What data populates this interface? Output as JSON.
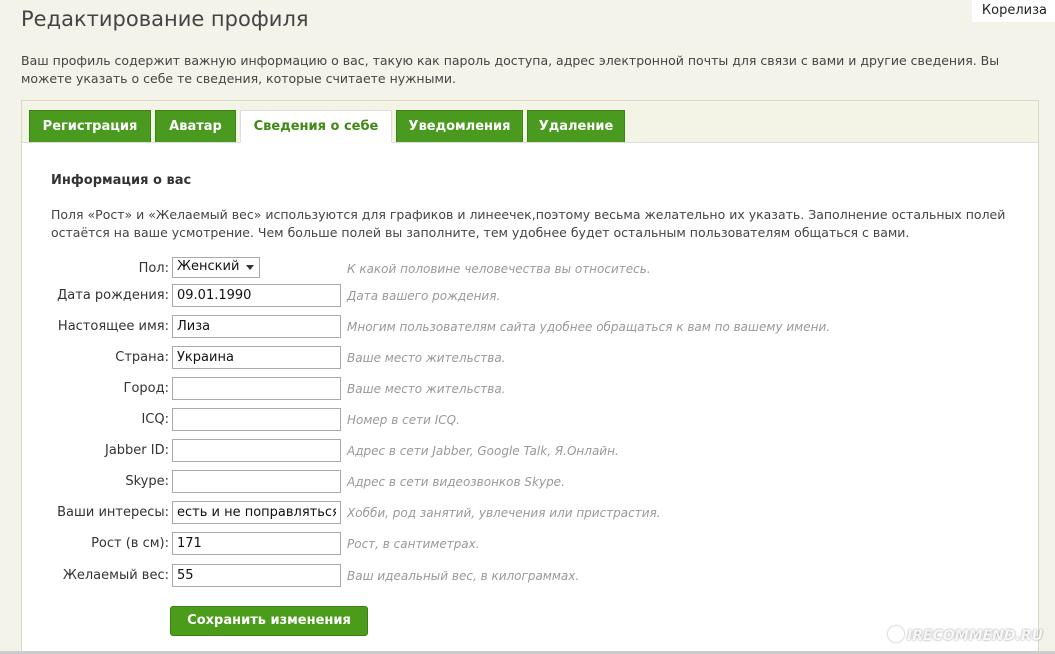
{
  "page": {
    "title": "Редактирование профиля",
    "user_name": "Корелиза",
    "intro": "Ваш профиль содержит важную информацию о вас, такую как пароль доступа, адрес электронной почты для связи с вами и другие сведения. Вы можете указать о себе те сведения, которые считаете нужными."
  },
  "tabs": [
    {
      "label": "Регистрация"
    },
    {
      "label": "Аватар"
    },
    {
      "label": "Сведения о себе"
    },
    {
      "label": "Уведомления"
    },
    {
      "label": "Удаление"
    }
  ],
  "active_tab": "Сведения о себе",
  "section": {
    "title": "Информация о вас",
    "description": "Поля «Рост» и «Желаемый вес» используются для графиков и линеечек,поэтому весьма желательно их указать. Заполнение остальных полей остаётся на ваше усмотрение. Чем больше полей вы заполните, тем удобнее будет остальным пользователям общаться с вами."
  },
  "fields": {
    "gender": {
      "label": "Пол:",
      "value": "Женский",
      "hint": "К какой половине человечества вы относитесь."
    },
    "birthdate": {
      "label": "Дата рождения:",
      "value": "09.01.1990",
      "hint": "Дата вашего рождения."
    },
    "real_name": {
      "label": "Настоящее имя:",
      "value": "Лиза",
      "hint": "Многим пользователям сайта удобнее обращаться к вам по вашему имени."
    },
    "country": {
      "label": "Страна:",
      "value": "Украина",
      "hint": "Ваше место жительства."
    },
    "city": {
      "label": "Город:",
      "value": "",
      "hint": "Ваше место жительства."
    },
    "icq": {
      "label": "ICQ:",
      "value": "",
      "hint": "Номер в сети ICQ."
    },
    "jabber": {
      "label": "Jabber ID:",
      "value": "",
      "hint": "Адрес в сети Jabber, Google Talk, Я.Онлайн."
    },
    "skype": {
      "label": "Skype:",
      "value": "",
      "hint": "Адрес в сети видеозвонков Skype."
    },
    "interests": {
      "label": "Ваши интересы:",
      "value": "есть и не поправляться",
      "hint": "Хобби, род занятий, увлечения или пристрастия."
    },
    "height": {
      "label": "Рост (в см):",
      "value": "171",
      "hint": "Рост, в сантиметрах."
    },
    "target_weight": {
      "label": "Желаемый вес:",
      "value": "55",
      "hint": "Ваш идеальный вес, в килограммах."
    }
  },
  "save_label": "Сохранить изменения",
  "watermark": "IRECOMMEND.RU",
  "colors": {
    "accent_green": "#4a9a1f",
    "active_tab_text": "#3e8a12"
  }
}
